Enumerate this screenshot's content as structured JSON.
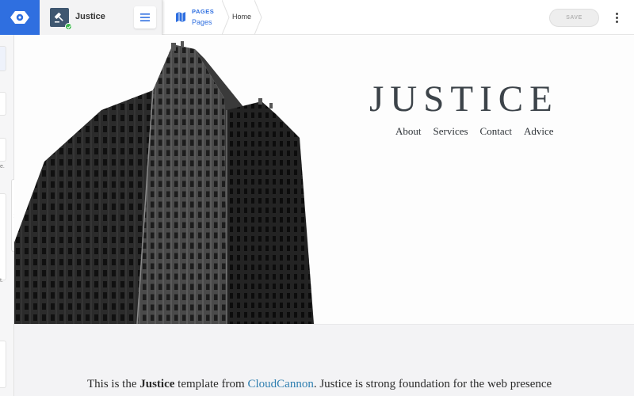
{
  "app": {
    "name": "CloudCannon",
    "accent": "#2f6fe0"
  },
  "site": {
    "name": "Justice",
    "status": "published"
  },
  "breadcrumb": {
    "section_kicker": "PAGES",
    "section": "Pages",
    "page": "Home"
  },
  "toolbar": {
    "save_label": "SAVE"
  },
  "sidebar": {
    "fragment_1": "e.",
    "fragment_2": "t."
  },
  "hero": {
    "title": "JUSTICE",
    "nav": [
      "About",
      "Services",
      "Contact",
      "Advice"
    ]
  },
  "intro": {
    "prefix": "This is the ",
    "template_name": "Justice",
    "middle": " template from ",
    "link_text": "CloudCannon",
    "suffix": ". Justice is strong foundation for the web presence"
  }
}
